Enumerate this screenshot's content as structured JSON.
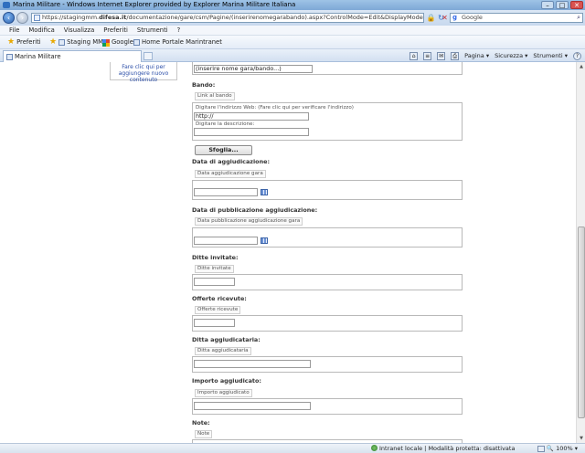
{
  "window": {
    "title": "Marina Militare - Windows Internet Explorer provided by Explorer Marina Militare Italiana",
    "controls": {
      "minimize": "–",
      "maximize": "□",
      "close": "✕"
    }
  },
  "address": {
    "url_prefix": "https://stagingmm.",
    "url_domain": "difesa.it",
    "url_rest": "/documentazione/gare/csm/Pagine/(inserirenomegarabando).aspx?ControlMode=Edit&DisplayMode=Design",
    "search_placeholder": "Google",
    "icons": [
      "lock-icon",
      "refresh-icon",
      "stop-icon",
      "search-icon"
    ]
  },
  "menu": [
    "File",
    "Modifica",
    "Visualizza",
    "Preferiti",
    "Strumenti",
    "?"
  ],
  "favorites": {
    "label": "Preferiti",
    "items": [
      "Staging MM",
      "Google",
      "Home Portale Marintranet"
    ]
  },
  "tab": {
    "label": "Marina Militare"
  },
  "commands": {
    "page": "Pagina ▾",
    "security": "Sicurezza ▾",
    "tools": "Strumenti ▾"
  },
  "left_panel": {
    "link": "Fare clic qui per aggiungere nuovo contenuto"
  },
  "form": {
    "title_value": "(inserire nome gara/bando...)",
    "bando": {
      "label": "Bando:",
      "chip": "Link al bando",
      "url_hint": "Digitare l'indirizzo Web: (Fare clic qui per verificare l'indirizzo)",
      "url_value": "http://",
      "desc_hint": "Digitare la descrizione:",
      "browse_button": "Sfoglia..."
    },
    "data_aggiudicazione": {
      "label": "Data di aggiudicazione:",
      "chip": "Data aggiudicazione gara"
    },
    "data_pubblicazione": {
      "label": "Data di pubblicazione aggiudicazione:",
      "chip": "Data pubblicazione aggiudicazione gara"
    },
    "ditte_invitate": {
      "label": "Ditte invitate:",
      "chip": "Ditte invitate"
    },
    "offerte_ricevute": {
      "label": "Offerte ricevute:",
      "chip": "Offerte ricevute"
    },
    "ditta_aggiudicataria": {
      "label": "Ditta aggiudicataria:",
      "chip": "Ditta aggiudicataria"
    },
    "importo_aggiudicato": {
      "label": "Importo aggiudicato:",
      "chip": "Importo aggiudicato"
    },
    "note": {
      "label": "Note:",
      "chip": "Note"
    }
  },
  "status": {
    "zone": "Intranet locale | Modalità protetta: disattivata",
    "zoom": "100%"
  }
}
